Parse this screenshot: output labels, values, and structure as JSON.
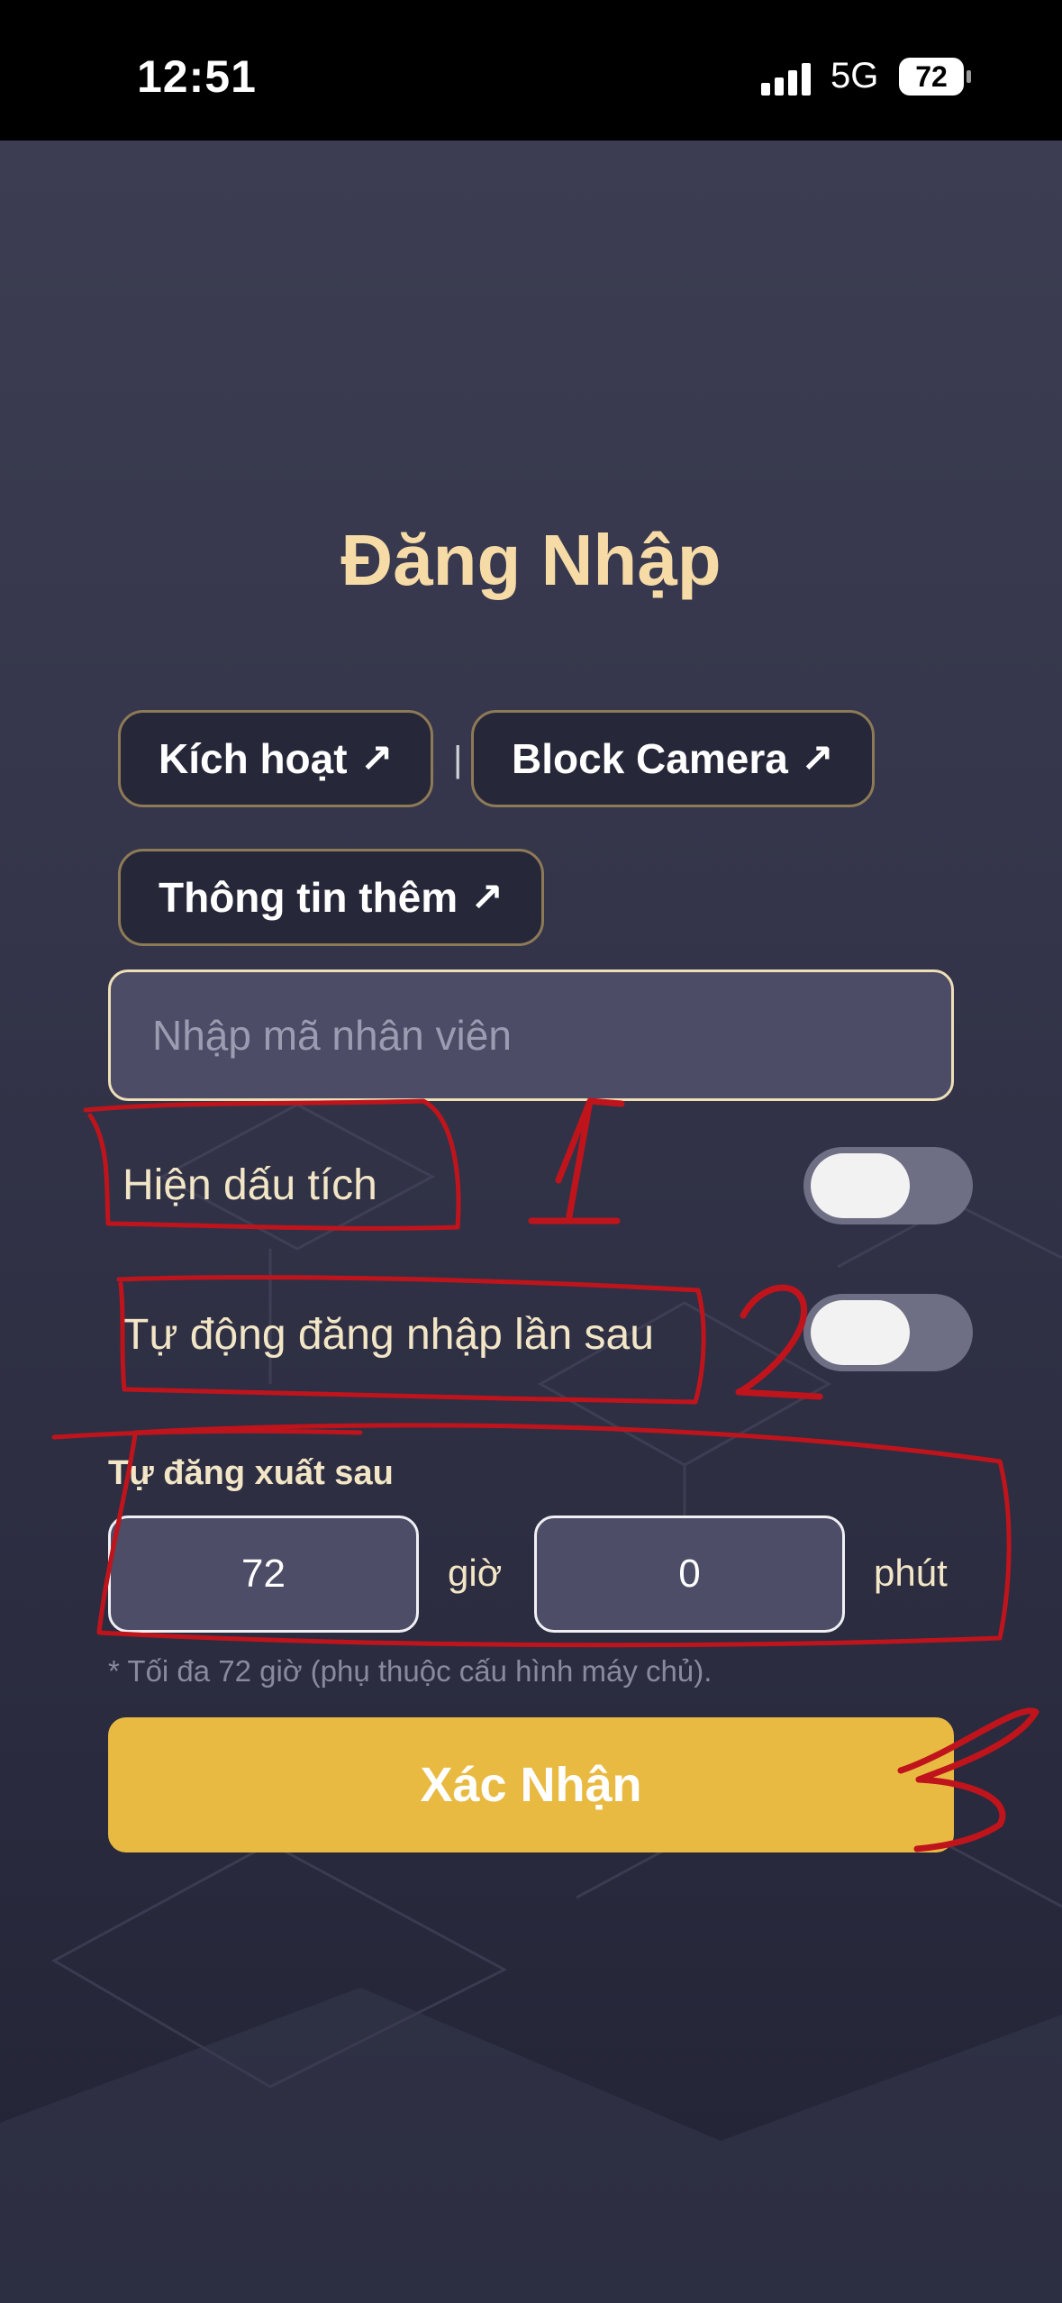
{
  "status_bar": {
    "time": "12:51",
    "network": "5G",
    "battery": "72",
    "icons": [
      "signal-icon",
      "battery-icon"
    ]
  },
  "login": {
    "title": "Đăng Nhập",
    "links": [
      {
        "label": "Kích hoạt",
        "icon": "arrow-up-right-icon"
      },
      {
        "label": "Block Camera",
        "icon": "arrow-up-right-icon"
      },
      {
        "label": "Thông tin thêm",
        "icon": "arrow-up-right-icon"
      }
    ],
    "link_separator": "|",
    "employee_input": {
      "placeholder": "Nhập mã nhân viên",
      "value": ""
    },
    "toggles": [
      {
        "label": "Hiện dấu tích",
        "on": false
      },
      {
        "label": "Tự động đăng nhập lần sau",
        "on": false
      }
    ],
    "auto_logout": {
      "label": "Tự đăng xuất sau",
      "hours": "72",
      "hours_unit": "giờ",
      "minutes": "0",
      "minutes_unit": "phút",
      "note": "* Tối đa 72 giờ (phụ thuộc cấu hình máy chủ)."
    },
    "confirm_label": "Xác Nhận"
  },
  "annotations": {
    "markers": [
      "1",
      "2",
      "3"
    ],
    "color": "#c0141c"
  },
  "colors": {
    "accent": "#e9ba42",
    "title": "#f6dba6",
    "background": "#2e2f42"
  }
}
